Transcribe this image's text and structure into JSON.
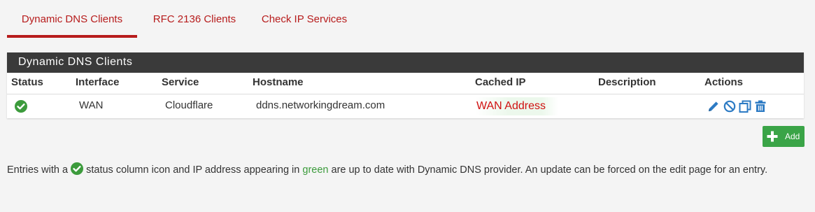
{
  "tabs": [
    {
      "label": "Dynamic DNS Clients",
      "active": true
    },
    {
      "label": "RFC 2136 Clients",
      "active": false
    },
    {
      "label": "Check IP Services",
      "active": false
    }
  ],
  "panel": {
    "title": "Dynamic DNS Clients",
    "columns": [
      "Status",
      "Interface",
      "Service",
      "Hostname",
      "Cached IP",
      "Description",
      "Actions"
    ],
    "rows": [
      {
        "status_icon": "check-circle-icon",
        "interface": "WAN",
        "service": "Cloudflare",
        "hostname": "ddns.networkingdream.com",
        "cached_ip": "WAN Address",
        "description": "",
        "actions": [
          "edit-pencil-icon",
          "disable-icon",
          "copy-icon",
          "delete-trash-icon"
        ]
      }
    ]
  },
  "add_button": {
    "label": "Add",
    "icon": "plus-icon"
  },
  "note": {
    "part1": "Entries with a",
    "part2": "status column icon and IP address appearing in",
    "green_word": "green",
    "part3": "are up to date with Dynamic DNS provider. An update can be forced on the edit page for an entry."
  },
  "colors": {
    "accent": "#b71c1c",
    "header_bg": "#3a3a3a",
    "ok_green": "#3c9b3c",
    "add_green": "#3aa447",
    "action_blue": "#2d7bc4",
    "cached_ip_red": "#d01010"
  }
}
